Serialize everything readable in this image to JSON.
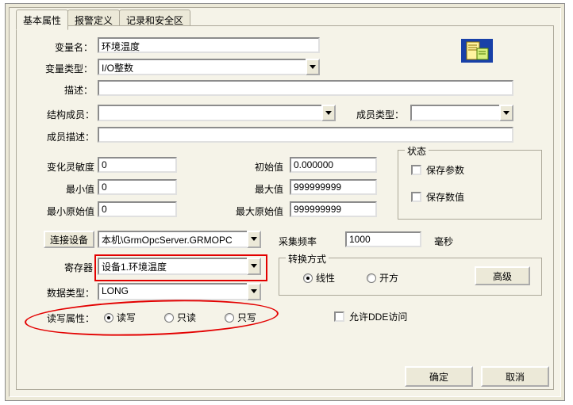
{
  "tabs": {
    "basic_attr": "基本属性",
    "alarm_def": "报警定义",
    "record_safe": "记录和安全区"
  },
  "labels": {
    "var_name": "变量名：",
    "var_type": "变量类型：",
    "description": "描述：",
    "struct_member": "结构成员：",
    "member_type": "成员类型：",
    "member_desc": "成员描述：",
    "change_sens": "变化灵敏度",
    "init_value": "初始值",
    "min_value": "最小值",
    "max_value": "最大值",
    "min_raw": "最小原始值",
    "max_raw": "最大原始值",
    "connect_dev": "连接设备",
    "register": "寄存器",
    "data_type": "数据类型：",
    "rw_attr": "读写属性：",
    "sample_freq": "采集频率",
    "ms": "毫秒",
    "convert_mode": "转换方式",
    "state_group": "状态",
    "save_param": "保存参数",
    "save_value": "保存数值",
    "linear": "线性",
    "sqrt": "开方",
    "advanced": "高级",
    "rw": "读写",
    "ro": "只读",
    "wo": "只写",
    "allow_dde": "允许DDE访问",
    "ok": "确定",
    "cancel": "取消"
  },
  "values": {
    "var_name": "环境温度",
    "var_type": "I/O整数",
    "description": "",
    "struct_member": "",
    "member_type": "",
    "member_desc": "",
    "change_sens": "0",
    "init_value": "0.000000",
    "min_value": "0",
    "max_value": "999999999",
    "min_raw": "0",
    "max_raw": "999999999",
    "connect_dev": "本机\\GrmOpcServer.GRMOPC",
    "register": "设备1.环境温度",
    "data_type": "LONG",
    "sample_freq": "1000",
    "rw_selected": "rw",
    "convert_selected": "linear",
    "save_param": false,
    "save_value": false,
    "allow_dde": false
  }
}
